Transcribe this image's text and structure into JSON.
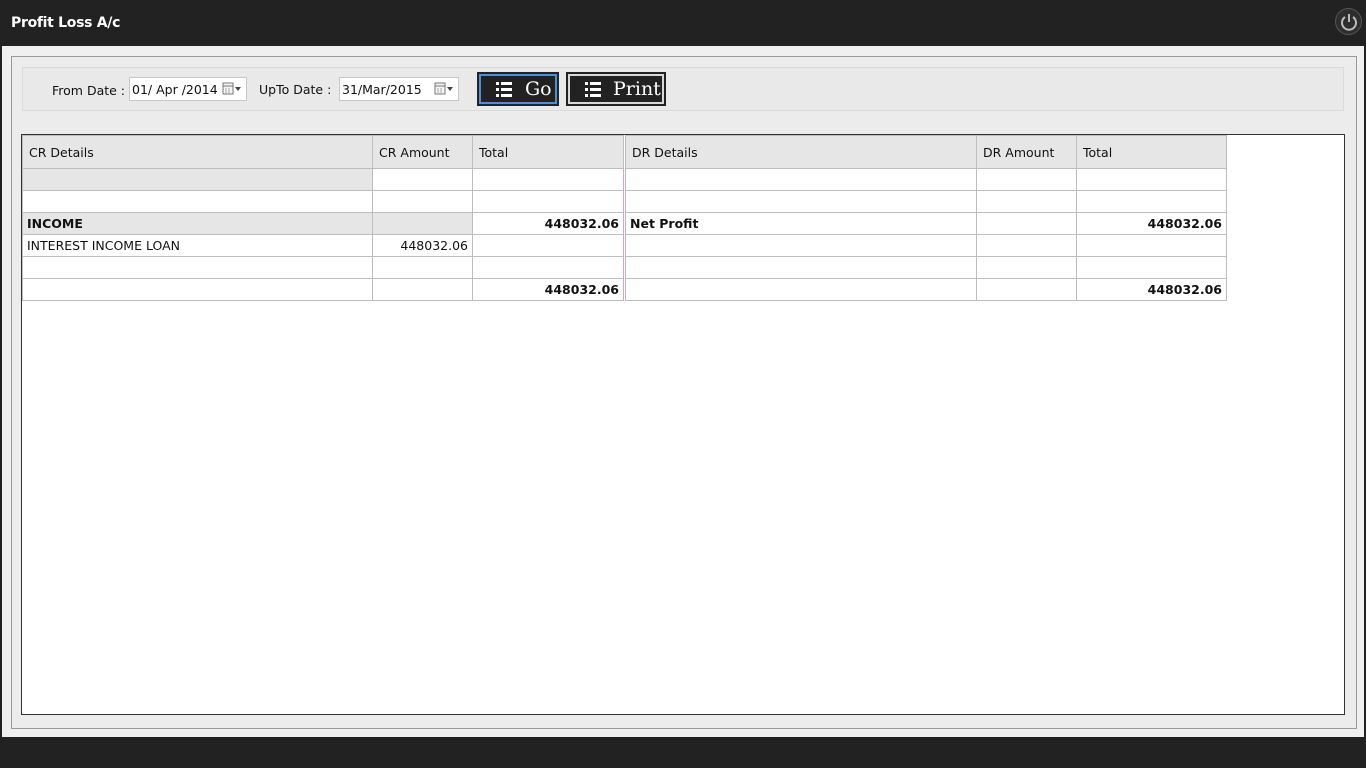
{
  "window": {
    "title": "Profit  Loss A/c",
    "power_icon": "power-icon"
  },
  "toolbar": {
    "from_label": "From Date :",
    "from_value": "01/ Apr /2014",
    "upto_label": "UpTo Date :",
    "upto_value": "31/Mar/2015",
    "calendar_icon": "calendar-dropdown-icon",
    "go_label": "Go",
    "print_label": "Print",
    "button_icon": "list-icon"
  },
  "grid": {
    "columns": [
      "CR Details",
      "CR Amount",
      "Total",
      "DR Details",
      "DR Amount",
      "Total"
    ],
    "rows": [
      [
        "",
        "",
        "",
        "",
        "",
        ""
      ],
      [
        "",
        "",
        "",
        "",
        "",
        ""
      ],
      [
        "INCOME",
        "",
        "448032.06",
        "Net Profit",
        "",
        "448032.06"
      ],
      [
        "INTEREST INCOME LOAN",
        "448032.06",
        "",
        "",
        "",
        ""
      ],
      [
        "",
        "",
        "",
        "",
        "",
        ""
      ],
      [
        "",
        "",
        "448032.06",
        "",
        "",
        "448032.06"
      ]
    ]
  },
  "colors": {
    "chrome": "#222222",
    "background": "#f0f0f0",
    "header": "#e6e6e6",
    "go_focus": "#4c8fd6"
  }
}
